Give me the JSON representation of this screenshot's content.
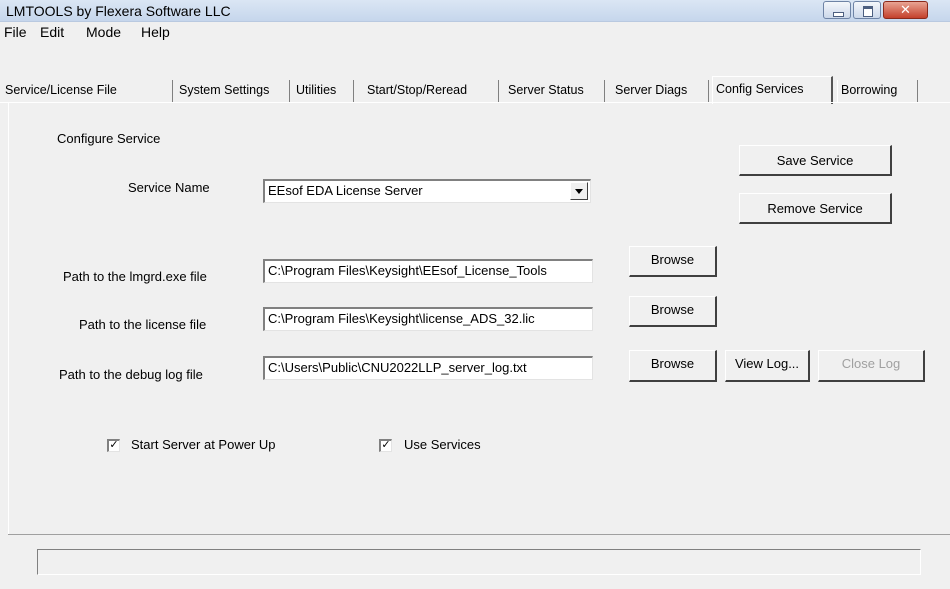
{
  "window": {
    "title": "LMTOOLS by Flexera Software LLC"
  },
  "menu": [
    "File",
    "Edit",
    "Mode",
    "Help"
  ],
  "tabs": [
    "Service/License File",
    "System Settings",
    "Utilities",
    "Start/Stop/Reread",
    "Server Status",
    "Server Diags",
    "Config Services",
    "Borrowing"
  ],
  "active_tab": "Config Services",
  "config": {
    "section_label": "Configure Service",
    "service_name_label": "Service Name",
    "service_name_value": "EEsof EDA License Server",
    "lmgrd_label": "Path to the lmgrd.exe file",
    "lmgrd_value": "C:\\Program Files\\Keysight\\EEsof_License_Tools",
    "license_label": "Path to the license file",
    "license_value": "C:\\Program Files\\Keysight\\license_ADS_32.lic",
    "debug_label": "Path to the debug log file",
    "debug_value": "C:\\Users\\Public\\CNU2022LLP_server_log.txt"
  },
  "buttons": {
    "save_service": "Save Service",
    "remove_service": "Remove Service",
    "browse": "Browse",
    "view_log": "View Log...",
    "close_log": "Close Log"
  },
  "checkboxes": {
    "start_at_power_up": {
      "label": "Start Server at Power Up",
      "checked": true
    },
    "use_services": {
      "label": "Use Services",
      "checked": true
    }
  },
  "status": {
    "text": ""
  }
}
